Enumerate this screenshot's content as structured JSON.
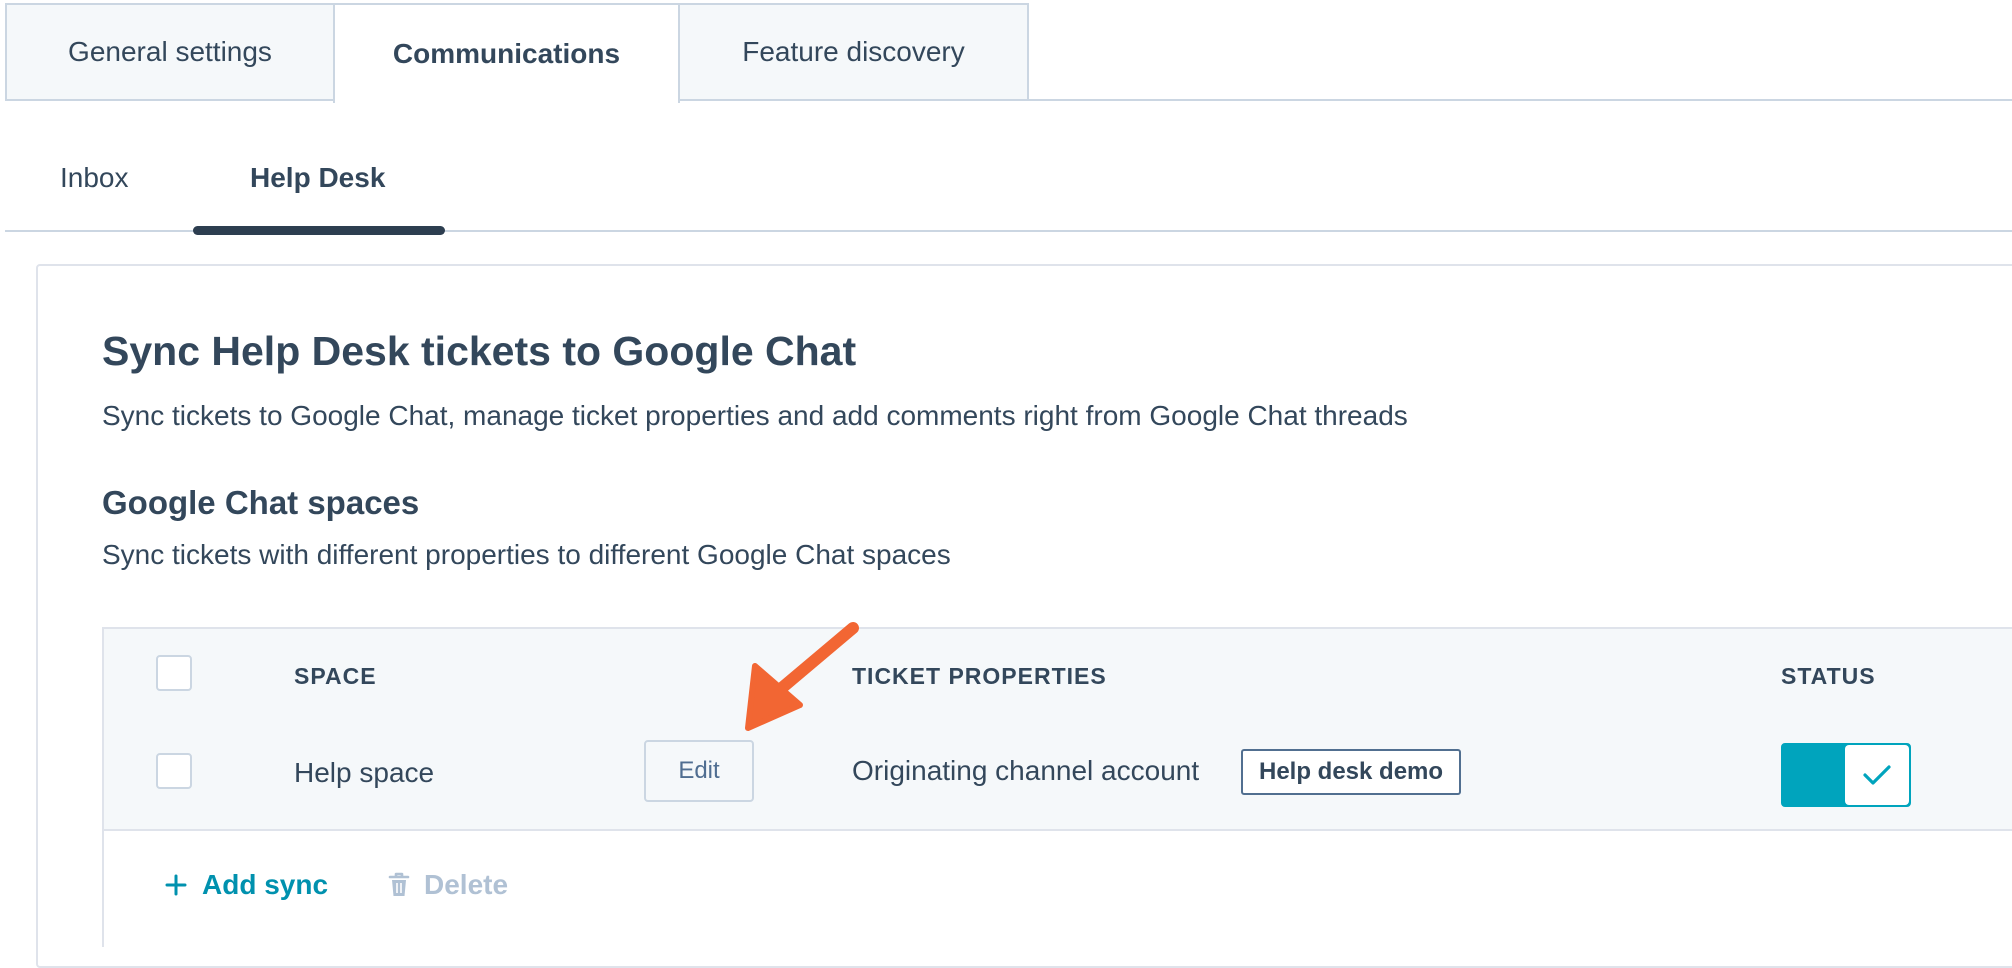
{
  "top_tabs": [
    {
      "label": "General settings"
    },
    {
      "label": "Communications",
      "active": true
    },
    {
      "label": "Feature discovery"
    }
  ],
  "sub_tabs": [
    {
      "label": "Inbox"
    },
    {
      "label": "Help Desk",
      "active": true
    }
  ],
  "section": {
    "title": "Sync Help Desk tickets to Google Chat",
    "subtitle": "Sync tickets to Google Chat, manage ticket properties and add comments right from Google Chat threads",
    "spaces_heading": "Google Chat spaces",
    "spaces_description": "Sync tickets with different properties to different Google Chat spaces"
  },
  "table": {
    "headers": {
      "space": "SPACE",
      "ticket_properties": "TICKET PROPERTIES",
      "status": "STATUS"
    },
    "rows": [
      {
        "space": "Help space",
        "edit_label": "Edit",
        "property_label": "Originating channel account",
        "property_value": "Help desk demo",
        "status_enabled": true
      }
    ],
    "footer": {
      "add_label": "Add sync",
      "delete_label": "Delete"
    }
  },
  "annotation": {
    "arrow_color": "#f26633",
    "points_to": "Edit"
  },
  "colors": {
    "text": "#33475b",
    "accent": "#00a4bd",
    "link": "#0091ae",
    "disabled": "#b0c1d4",
    "border": "#cbd6e2"
  },
  "icons": [
    "plus-icon",
    "trash-icon",
    "checkmark-icon",
    "arrow-annotation"
  ]
}
